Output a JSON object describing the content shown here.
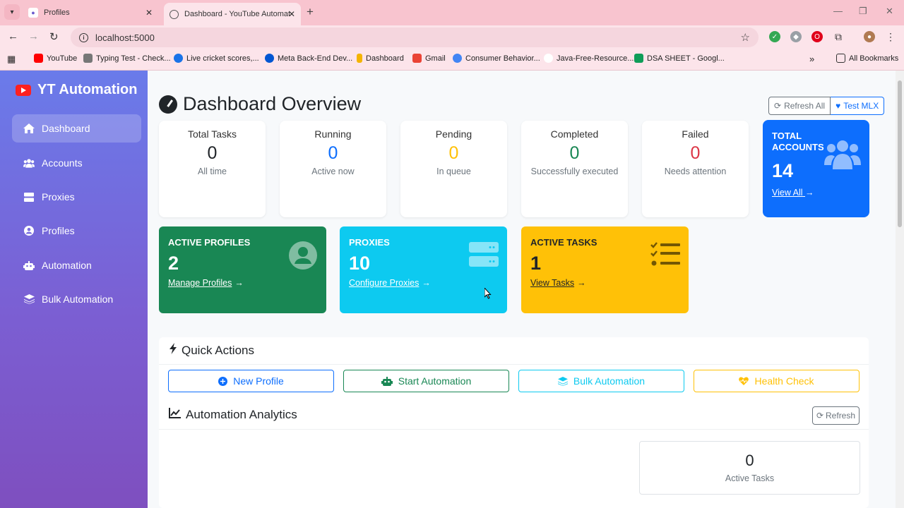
{
  "browser": {
    "tabs": [
      {
        "title": "Profiles"
      },
      {
        "title": "Dashboard - YouTube Automat"
      }
    ],
    "url": "localhost:5000",
    "bookmarks": [
      {
        "label": "YouTube",
        "color": "#ff0000"
      },
      {
        "label": "Typing Test - Check...",
        "color": "#777777"
      },
      {
        "label": "Live cricket scores,...",
        "color": "#1a73e8"
      },
      {
        "label": "Meta Back-End Dev...",
        "color": "#0056d2"
      },
      {
        "label": "Dashboard",
        "color": "#f4b400"
      },
      {
        "label": "Gmail",
        "color": "#ea4335"
      },
      {
        "label": "Consumer Behavior...",
        "color": "#4285f4"
      },
      {
        "label": "Java-Free-Resource...",
        "color": "#cccccc"
      },
      {
        "label": "DSA SHEET - Googl...",
        "color": "#0f9d58"
      }
    ],
    "all_bookmarks": "All Bookmarks"
  },
  "sidebar": {
    "brand": "YT Automation",
    "items": [
      {
        "label": "Dashboard",
        "icon": "home-icon",
        "active": true
      },
      {
        "label": "Accounts",
        "icon": "users-icon"
      },
      {
        "label": "Proxies",
        "icon": "server-icon"
      },
      {
        "label": "Profiles",
        "icon": "user-circle-icon"
      },
      {
        "label": "Automation",
        "icon": "robot-icon"
      },
      {
        "label": "Bulk Automation",
        "icon": "layers-icon"
      }
    ]
  },
  "header": {
    "title": "Dashboard Overview",
    "refresh_all": "Refresh All",
    "test_mlx": "Test MLX"
  },
  "stats": [
    {
      "label": "Total Tasks",
      "value": "0",
      "sub": "All time",
      "color": "#212529"
    },
    {
      "label": "Running",
      "value": "0",
      "sub": "Active now",
      "color": "#0d6efd"
    },
    {
      "label": "Pending",
      "value": "0",
      "sub": "In queue",
      "color": "#ffc107"
    },
    {
      "label": "Completed",
      "value": "0",
      "sub": "Successfully executed",
      "color": "#198754"
    },
    {
      "label": "Failed",
      "value": "0",
      "sub": "Needs attention",
      "color": "#dc3545"
    }
  ],
  "total_accounts": {
    "label": "TOTAL ACCOUNTS",
    "value": "14",
    "link": "View All",
    "color": "#0d6efd"
  },
  "cards": [
    {
      "title": "ACTIVE PROFILES",
      "value": "2",
      "link": "Manage Profiles",
      "color": "#198754"
    },
    {
      "title": "PROXIES",
      "value": "10",
      "link": "Configure Proxies",
      "color": "#0dcaf0"
    },
    {
      "title": "ACTIVE TASKS",
      "value": "1",
      "link": "View Tasks",
      "color": "#ffc107"
    }
  ],
  "quick_actions": {
    "title": "Quick Actions",
    "buttons": [
      {
        "label": "New Profile",
        "color": "#0d6efd"
      },
      {
        "label": "Start Automation",
        "color": "#198754"
      },
      {
        "label": "Bulk Automation",
        "color": "#0dcaf0"
      },
      {
        "label": "Health Check",
        "color": "#ffc107"
      }
    ]
  },
  "analytics": {
    "title": "Automation Analytics",
    "refresh": "Refresh",
    "active_tasks_value": "0",
    "active_tasks_label": "Active Tasks"
  }
}
